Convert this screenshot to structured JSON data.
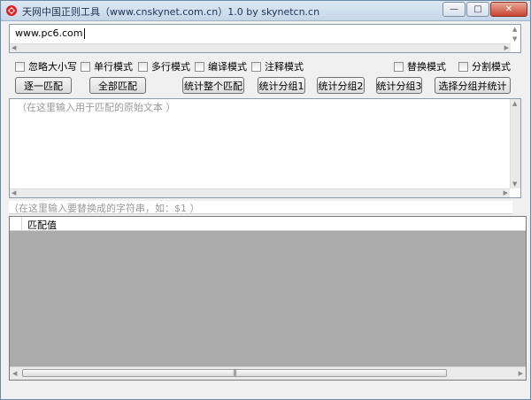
{
  "window": {
    "title": "天网中国正则工具（www.cnskynet.com.cn）1.0 by skynetcn.cn",
    "minimize": "—",
    "maximize": "□",
    "close": "✕"
  },
  "pattern": {
    "value": "www.pc6.com"
  },
  "options": [
    {
      "label": "忽略大小写",
      "checked": false
    },
    {
      "label": "单行模式",
      "checked": false
    },
    {
      "label": "多行模式",
      "checked": false
    },
    {
      "label": "编译模式",
      "checked": false
    },
    {
      "label": "注释模式",
      "checked": false
    },
    {
      "label": "替换模式",
      "checked": false
    },
    {
      "label": "分割模式",
      "checked": false
    }
  ],
  "buttons": [
    {
      "label": "逐一匹配"
    },
    {
      "label": "全部匹配"
    },
    {
      "label": "统计整个匹配"
    },
    {
      "label": "统计分组1"
    },
    {
      "label": "统计分组2"
    },
    {
      "label": "统计分组3"
    },
    {
      "label": "选择分组并统计"
    }
  ],
  "source": {
    "placeholder": "（在这里输入用于匹配的原始文本 ）"
  },
  "replace": {
    "placeholder": "（在这里输入要替换成的字符串，如：$1 ）"
  },
  "results": {
    "column": "匹配值"
  },
  "icons": {
    "app": "app-icon",
    "check": "checkbox"
  }
}
